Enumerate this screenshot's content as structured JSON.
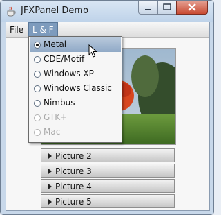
{
  "window": {
    "title": "JFXPanel Demo"
  },
  "menubar": {
    "file_label": "File",
    "lf_label": "L & F"
  },
  "lookandfeel_menu": {
    "items": [
      {
        "label": "Metal",
        "selected": true,
        "enabled": true
      },
      {
        "label": "CDE/Motif",
        "selected": false,
        "enabled": true
      },
      {
        "label": "Windows XP",
        "selected": false,
        "enabled": true
      },
      {
        "label": "Windows Classic",
        "selected": false,
        "enabled": true
      },
      {
        "label": "Nimbus",
        "selected": false,
        "enabled": true
      },
      {
        "label": "GTK+",
        "selected": false,
        "enabled": false
      },
      {
        "label": "Mac",
        "selected": false,
        "enabled": false
      }
    ]
  },
  "accordion": {
    "items": [
      {
        "label": "Picture 2"
      },
      {
        "label": "Picture 3"
      },
      {
        "label": "Picture 4"
      },
      {
        "label": "Picture 5"
      }
    ]
  }
}
